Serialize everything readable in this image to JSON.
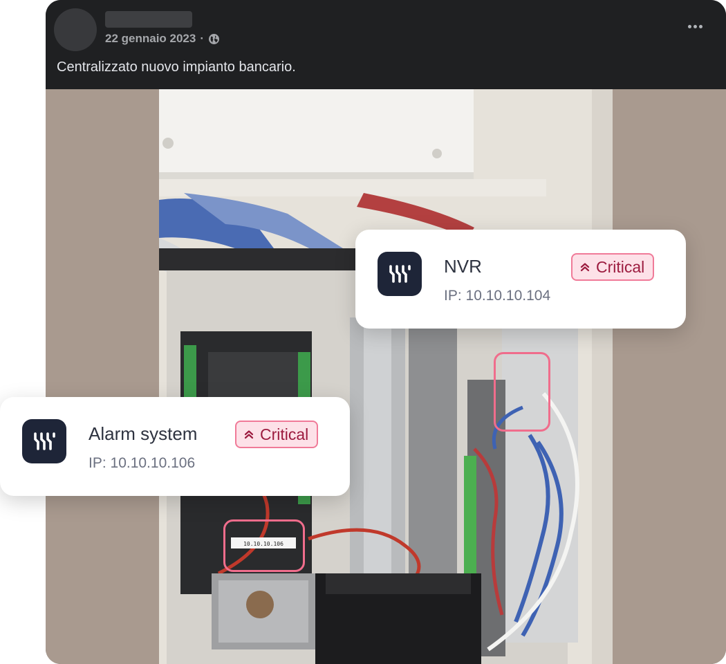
{
  "post": {
    "date": "22 gennaio 2023",
    "separator": "·",
    "visibility_icon": "globe-icon",
    "more_icon": "more-horizontal-icon",
    "text": "Centralizzato nuovo impianto bancario."
  },
  "cards": {
    "nvr": {
      "title": "NVR",
      "ip": "IP: 10.10.10.104",
      "badge": "Critical",
      "badge_icon": "chevrons-up-icon"
    },
    "alarm": {
      "title": "Alarm system",
      "ip": "IP: 10.10.10.106",
      "badge": "Critical",
      "badge_icon": "chevrons-up-icon"
    }
  },
  "photo_label_text": "10.10.10.106",
  "colors": {
    "badge_border": "#f07a98",
    "badge_bg": "#fde1e8",
    "badge_text": "#9c1b3f",
    "highlight": "#f06d8c",
    "logo_bg": "#1e2538",
    "header_bg": "#1f2022"
  }
}
